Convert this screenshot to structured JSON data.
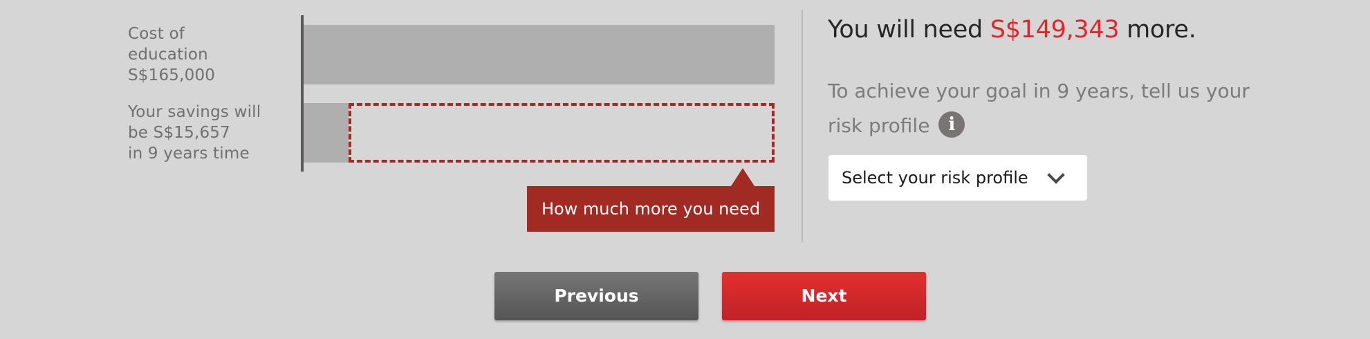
{
  "chart": {
    "cost_label_lines": [
      "Cost of",
      "education",
      "S$165,000"
    ],
    "savings_label_lines": [
      "Your savings will",
      "be S$15,657",
      "in 9 years time"
    ],
    "cost_value": 165000,
    "savings_value": 15657,
    "shortfall_value": 149343,
    "tooltip": "How much more you need"
  },
  "result": {
    "prefix": "You will need ",
    "amount": "S$149,343",
    "suffix": " more."
  },
  "prompt": {
    "text": "To achieve your goal in 9 years, tell us your risk profile"
  },
  "info_icon": {
    "glyph": "i",
    "icon": "info-icon"
  },
  "risk_select": {
    "selected": "Select your risk profile",
    "icon": "chevron-down-icon"
  },
  "buttons": {
    "previous": "Previous",
    "next": "Next"
  },
  "colors": {
    "background": "#d6d6d6",
    "bar": "#afafaf",
    "shortfall": "#a12a23",
    "accent": "#e0262b",
    "next_button": "#d6282b",
    "previous_button": "#656565"
  }
}
